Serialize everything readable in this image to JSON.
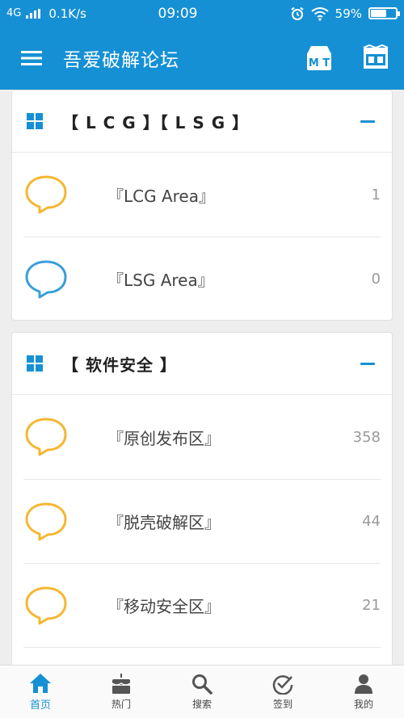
{
  "status_bar": {
    "network": "4G",
    "speed": "0.1K/s",
    "time": "09:09",
    "battery": "59%",
    "battery_level": 0.59
  },
  "app_bar": {
    "title": "吾爱破解论坛",
    "icons": [
      "mt-manager-icon",
      "wuai-icon"
    ]
  },
  "colors": {
    "primary": "#1690d4",
    "bubble_yellow": "#f5b731",
    "bubble_blue": "#3a9fd8"
  },
  "sections": [
    {
      "title": "【 L C G 】【 L S G 】",
      "forums": [
        {
          "name": "『LCG Area』",
          "count": "1",
          "icon_color": "yellow"
        },
        {
          "name": "『LSG Area』",
          "count": "0",
          "icon_color": "blue"
        }
      ]
    },
    {
      "title": "【 软件安全 】",
      "forums": [
        {
          "name": "『原创发布区』",
          "count": "358",
          "icon_color": "yellow"
        },
        {
          "name": "『脱壳破解区』",
          "count": "44",
          "icon_color": "yellow"
        },
        {
          "name": "『移动安全区』",
          "count": "21",
          "icon_color": "yellow"
        }
      ]
    }
  ],
  "bottom_nav": [
    {
      "label": "首页",
      "icon": "home-icon",
      "active": true
    },
    {
      "label": "热门",
      "icon": "cake-icon",
      "active": false
    },
    {
      "label": "搜索",
      "icon": "search-icon",
      "active": false
    },
    {
      "label": "签到",
      "icon": "check-circle-icon",
      "active": false
    },
    {
      "label": "我的",
      "icon": "user-icon",
      "active": false
    }
  ]
}
